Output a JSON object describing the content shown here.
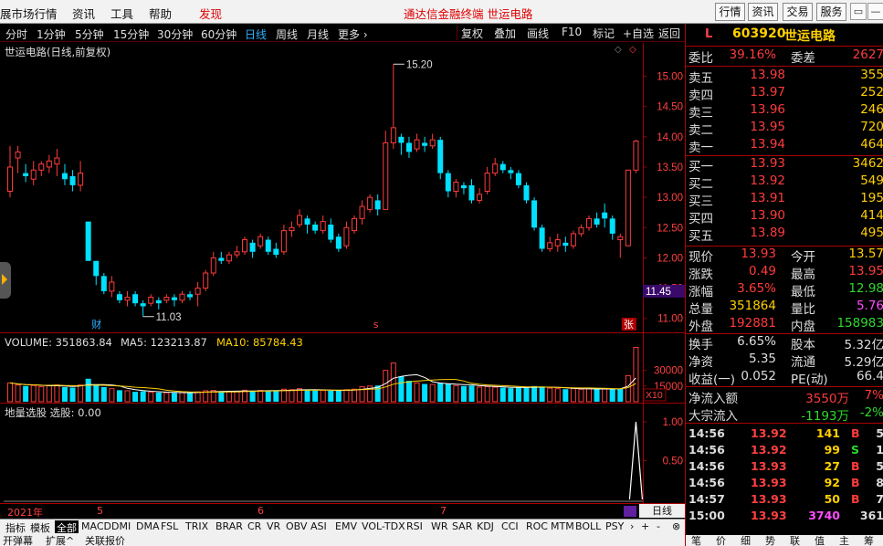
{
  "menubar": {
    "items": [
      "展市场行情",
      "资讯",
      "工具",
      "帮助",
      "发现"
    ],
    "title": "通达信金融终端   世运电路",
    "buttons": [
      "行情",
      "资讯",
      "交易",
      "服务"
    ],
    "win": [
      "▭",
      "—",
      "▢",
      "✕"
    ]
  },
  "periods": {
    "items": [
      "分时",
      "1分钟",
      "5分钟",
      "15分钟",
      "30分钟",
      "60分钟",
      "日线",
      "周线",
      "月线",
      "更多 ›"
    ],
    "active": 6,
    "tools": [
      "复权",
      "叠加",
      "画线",
      "F10",
      "标记",
      "+自选",
      "返回"
    ]
  },
  "chart": {
    "title": "世运电路(日线,前复权)",
    "high_label": "15.20",
    "low_label": "11.03",
    "price_flag": "11.45",
    "yticks": [
      "15.00",
      "14.50",
      "14.00",
      "13.50",
      "13.00",
      "12.50",
      "12.00",
      "11.50",
      "11.00"
    ],
    "markers": {
      "cai": "财",
      "s": "s",
      "zhang": "张"
    },
    "candles": [
      [
        13.1,
        13.5,
        13.0,
        13.85
      ],
      [
        13.65,
        13.75,
        13.4,
        13.85
      ],
      [
        13.4,
        13.35,
        13.25,
        13.55
      ],
      [
        13.3,
        13.45,
        13.2,
        13.6
      ],
      [
        13.45,
        13.55,
        13.35,
        13.6
      ],
      [
        13.5,
        13.6,
        13.4,
        13.7
      ],
      [
        13.55,
        13.65,
        13.35,
        13.8
      ],
      [
        13.4,
        13.3,
        13.2,
        13.55
      ],
      [
        13.35,
        13.2,
        13.1,
        13.45
      ],
      [
        13.2,
        13.4,
        13.1,
        13.6
      ],
      [
        12.6,
        11.95,
        11.95,
        12.6
      ],
      [
        11.95,
        11.7,
        11.55,
        11.95
      ],
      [
        11.7,
        11.45,
        11.4,
        11.75
      ],
      [
        11.45,
        11.6,
        11.35,
        11.7
      ],
      [
        11.4,
        11.3,
        11.25,
        11.45
      ],
      [
        11.3,
        11.35,
        11.2,
        11.45
      ],
      [
        11.4,
        11.25,
        11.2,
        11.45
      ],
      [
        11.25,
        11.2,
        11.03,
        11.3
      ],
      [
        11.25,
        11.35,
        11.2,
        11.4
      ],
      [
        11.3,
        11.25,
        11.15,
        11.35
      ],
      [
        11.3,
        11.35,
        11.25,
        11.4
      ],
      [
        11.35,
        11.3,
        11.2,
        11.4
      ],
      [
        11.3,
        11.4,
        11.25,
        11.45
      ],
      [
        11.4,
        11.35,
        11.3,
        11.45
      ],
      [
        11.4,
        11.5,
        11.2,
        11.6
      ],
      [
        11.5,
        11.75,
        11.45,
        11.8
      ],
      [
        11.75,
        12.0,
        11.7,
        12.1
      ],
      [
        12.0,
        11.95,
        11.9,
        12.1
      ],
      [
        11.95,
        12.05,
        11.9,
        12.1
      ],
      [
        12.05,
        12.1,
        12.0,
        12.2
      ],
      [
        12.1,
        12.3,
        12.05,
        12.35
      ],
      [
        12.25,
        12.1,
        12.0,
        12.3
      ],
      [
        12.2,
        12.35,
        12.15,
        12.4
      ],
      [
        12.3,
        12.1,
        12.05,
        12.35
      ],
      [
        12.15,
        12.05,
        12.0,
        12.25
      ],
      [
        12.1,
        12.45,
        12.05,
        12.55
      ],
      [
        12.45,
        12.5,
        12.35,
        12.6
      ],
      [
        12.55,
        12.7,
        12.5,
        12.8
      ],
      [
        12.65,
        12.55,
        12.4,
        12.7
      ],
      [
        12.55,
        12.45,
        12.4,
        12.6
      ],
      [
        12.45,
        12.6,
        12.4,
        12.7
      ],
      [
        12.55,
        12.3,
        12.25,
        12.65
      ],
      [
        12.35,
        12.15,
        12.1,
        12.4
      ],
      [
        12.2,
        12.5,
        12.15,
        12.6
      ],
      [
        12.45,
        12.65,
        12.4,
        12.7
      ],
      [
        12.65,
        12.85,
        12.55,
        12.95
      ],
      [
        12.8,
        13.0,
        12.75,
        13.05
      ],
      [
        12.95,
        12.8,
        12.7,
        13.05
      ],
      [
        12.8,
        13.9,
        12.8,
        14.1
      ],
      [
        13.9,
        14.15,
        13.8,
        15.2
      ],
      [
        14.0,
        13.9,
        13.7,
        14.05
      ],
      [
        13.9,
        13.75,
        13.65,
        14.0
      ],
      [
        13.8,
        13.95,
        13.75,
        14.05
      ],
      [
        13.9,
        13.85,
        13.75,
        14.0
      ],
      [
        13.85,
        13.95,
        13.8,
        14.05
      ],
      [
        13.95,
        13.4,
        13.3,
        14.0
      ],
      [
        13.4,
        13.1,
        13.0,
        13.45
      ],
      [
        13.1,
        13.25,
        13.0,
        13.3
      ],
      [
        13.2,
        13.15,
        13.05,
        13.25
      ],
      [
        13.2,
        12.95,
        12.9,
        13.3
      ],
      [
        12.95,
        13.05,
        12.9,
        13.15
      ],
      [
        13.1,
        13.4,
        13.05,
        13.5
      ],
      [
        13.4,
        13.55,
        13.35,
        13.65
      ],
      [
        13.55,
        13.45,
        13.4,
        13.6
      ],
      [
        13.45,
        13.4,
        13.3,
        13.5
      ],
      [
        13.4,
        13.2,
        13.15,
        13.45
      ],
      [
        13.2,
        12.95,
        12.9,
        13.25
      ],
      [
        12.95,
        12.5,
        12.45,
        13.0
      ],
      [
        12.5,
        12.15,
        12.1,
        12.55
      ],
      [
        12.15,
        12.25,
        12.1,
        12.35
      ],
      [
        12.2,
        12.3,
        12.1,
        12.4
      ],
      [
        12.25,
        12.2,
        12.1,
        12.35
      ],
      [
        12.2,
        12.4,
        12.15,
        12.45
      ],
      [
        12.4,
        12.5,
        12.35,
        12.55
      ],
      [
        12.5,
        12.65,
        12.45,
        12.7
      ],
      [
        12.65,
        12.55,
        12.5,
        12.75
      ],
      [
        12.75,
        12.65,
        12.5,
        12.9
      ],
      [
        12.65,
        12.4,
        12.3,
        12.7
      ],
      [
        12.3,
        12.35,
        12.0,
        12.4
      ],
      [
        12.2,
        13.45,
        12.2,
        13.45
      ],
      [
        13.45,
        13.93,
        13.4,
        13.95
      ]
    ],
    "volumes": [
      [
        18000,
        1
      ],
      [
        16000,
        1
      ],
      [
        15000,
        0
      ],
      [
        15500,
        1
      ],
      [
        14500,
        1
      ],
      [
        15500,
        1
      ],
      [
        16000,
        1
      ],
      [
        14000,
        0
      ],
      [
        13500,
        0
      ],
      [
        16000,
        1
      ],
      [
        22000,
        0
      ],
      [
        16000,
        0
      ],
      [
        14000,
        0
      ],
      [
        12500,
        1
      ],
      [
        11000,
        0
      ],
      [
        10500,
        1
      ],
      [
        9500,
        0
      ],
      [
        10000,
        0
      ],
      [
        9000,
        1
      ],
      [
        8800,
        0
      ],
      [
        8600,
        1
      ],
      [
        8500,
        0
      ],
      [
        8700,
        1
      ],
      [
        8600,
        0
      ],
      [
        9500,
        1
      ],
      [
        10500,
        1
      ],
      [
        10800,
        1
      ],
      [
        9800,
        0
      ],
      [
        9700,
        1
      ],
      [
        10000,
        1
      ],
      [
        11000,
        1
      ],
      [
        10500,
        0
      ],
      [
        10800,
        1
      ],
      [
        10600,
        0
      ],
      [
        10200,
        0
      ],
      [
        12000,
        1
      ],
      [
        11500,
        1
      ],
      [
        12500,
        1
      ],
      [
        11000,
        0
      ],
      [
        10800,
        0
      ],
      [
        11000,
        1
      ],
      [
        10500,
        0
      ],
      [
        10800,
        0
      ],
      [
        11500,
        1
      ],
      [
        12000,
        1
      ],
      [
        14500,
        1
      ],
      [
        15000,
        1
      ],
      [
        15500,
        0
      ],
      [
        30000,
        1
      ],
      [
        37000,
        1
      ],
      [
        24000,
        0
      ],
      [
        20000,
        0
      ],
      [
        18000,
        1
      ],
      [
        17000,
        0
      ],
      [
        16500,
        1
      ],
      [
        18000,
        0
      ],
      [
        17000,
        0
      ],
      [
        15500,
        1
      ],
      [
        15000,
        0
      ],
      [
        15500,
        0
      ],
      [
        14000,
        1
      ],
      [
        14500,
        1
      ],
      [
        14000,
        1
      ],
      [
        13500,
        0
      ],
      [
        13000,
        0
      ],
      [
        13500,
        0
      ],
      [
        14000,
        0
      ],
      [
        15000,
        0
      ],
      [
        14500,
        0
      ],
      [
        13000,
        1
      ],
      [
        12500,
        1
      ],
      [
        12000,
        0
      ],
      [
        12500,
        1
      ],
      [
        12000,
        1
      ],
      [
        12500,
        1
      ],
      [
        12000,
        0
      ],
      [
        12500,
        1
      ],
      [
        12000,
        0
      ],
      [
        12500,
        0
      ],
      [
        25000,
        1
      ],
      [
        52000,
        1
      ]
    ],
    "volume_header": {
      "vol": "VOLUME: 351863.84",
      "ma5": "MA5: 123213.87",
      "ma10": "MA10: 85784.43"
    },
    "vol_ticks": [
      "30000",
      "15000"
    ],
    "vol_unit": "X10",
    "ind_header": "地量选股  选股: 0.00",
    "ind_ticks": [
      "1.00",
      "0.50"
    ],
    "dates": [
      "2021年",
      "5",
      "6",
      "7"
    ]
  },
  "bottom": {
    "tabs": [
      "指标",
      "模板",
      "全部",
      "MACD",
      "DMI",
      "DMA",
      "FSL",
      "TRIX",
      "BRAR",
      "CR",
      "VR",
      "OBV",
      "ASI",
      "EMV",
      "VOL-TDX",
      "RSI",
      "WR",
      "SAR",
      "KDJ",
      "CCI",
      "ROC",
      "MTM",
      "BOLL",
      "PSY",
      "›"
    ],
    "controls": [
      "+",
      "-",
      "⊗"
    ],
    "status": [
      "开弹幕",
      "扩展^",
      "关联报价"
    ],
    "datebox": "日线"
  },
  "side": {
    "code": "603920",
    "name": "世运电路",
    "L": "L",
    "weibi": {
      "label": "委比",
      "v": "39.16%",
      "label2": "委差",
      "v2": "2627"
    },
    "asks": [
      [
        "卖五",
        "13.98",
        "355"
      ],
      [
        "卖四",
        "13.97",
        "252"
      ],
      [
        "卖三",
        "13.96",
        "246"
      ],
      [
        "卖二",
        "13.95",
        "720"
      ],
      [
        "卖一",
        "13.94",
        "464"
      ]
    ],
    "bids": [
      [
        "买一",
        "13.93",
        "3462"
      ],
      [
        "买二",
        "13.92",
        "549"
      ],
      [
        "买三",
        "13.91",
        "195"
      ],
      [
        "买四",
        "13.90",
        "414"
      ],
      [
        "买五",
        "13.89",
        "495"
      ]
    ],
    "stats": [
      [
        "现价",
        "13.93",
        "今开",
        "13.57"
      ],
      [
        "涨跌",
        "0.49",
        "最高",
        "13.95"
      ],
      [
        "涨幅",
        "3.65%",
        "最低",
        "12.98"
      ],
      [
        "总量",
        "351864",
        "量比",
        "5.76"
      ],
      [
        "外盘",
        "192881",
        "内盘",
        "158983"
      ]
    ],
    "stats2": [
      [
        "换手",
        "6.65%",
        "股本",
        "5.32亿"
      ],
      [
        "净资",
        "5.35",
        "流通",
        "5.29亿"
      ],
      [
        "收益(一)",
        "0.052",
        "PE(动)",
        "66.4"
      ]
    ],
    "flow": [
      [
        "净流入额",
        "3550万",
        "7%"
      ],
      [
        "大宗流入",
        "-1193万",
        "-2%"
      ]
    ],
    "ticks": [
      [
        "14:56",
        "13.92",
        "141",
        "B",
        "5"
      ],
      [
        "14:56",
        "13.92",
        "99",
        "S",
        "1"
      ],
      [
        "14:56",
        "13.93",
        "27",
        "B",
        "5"
      ],
      [
        "14:56",
        "13.93",
        "92",
        "B",
        "8"
      ],
      [
        "14:57",
        "13.93",
        "50",
        "B",
        "7"
      ],
      [
        "15:00",
        "13.93",
        "3740",
        "",
        "361"
      ]
    ],
    "tabs": [
      "笔",
      "价",
      "细",
      "势",
      "联",
      "值",
      "主",
      "筹"
    ]
  }
}
